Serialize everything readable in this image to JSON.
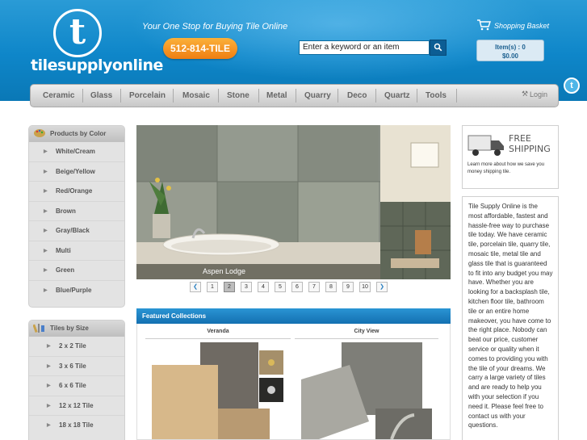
{
  "header": {
    "logo_letter": "t",
    "logo_text": "tilesupplyonline",
    "tagline": "Your One Stop for Buying Tile Online",
    "phone": "512-814-TILE",
    "search": {
      "value": "Enter a keyword or an item",
      "button_icon": "search-icon"
    },
    "basket": {
      "label": "Shopping Basket",
      "items_text": "Item(s) : 0",
      "total": "$0.00"
    }
  },
  "nav": {
    "items": [
      "Ceramic",
      "Glass",
      "Porcelain",
      "Mosaic",
      "Stone",
      "Metal",
      "Quarry",
      "Deco",
      "Quartz",
      "Tools"
    ],
    "login": "Login"
  },
  "sidebar": {
    "color": {
      "title": "Products by Color",
      "items": [
        "White/Cream",
        "Beige/Yellow",
        "Red/Orange",
        "Brown",
        "Gray/Black",
        "Multi",
        "Green",
        "Blue/Purple"
      ]
    },
    "size": {
      "title": "Tiles by Size",
      "items": [
        "2 x 2 Tile",
        "3 x 6 Tile",
        "6 x 6 Tile",
        "12 x 12 Tile",
        "18 x 18 Tile"
      ]
    }
  },
  "slider": {
    "caption": "Aspen Lodge",
    "pages": [
      "1",
      "2",
      "3",
      "4",
      "5",
      "6",
      "7",
      "8",
      "9",
      "10"
    ],
    "active_page": "2"
  },
  "featured": {
    "title": "Featured Collections",
    "collections": [
      "Veranda",
      "City View"
    ]
  },
  "shipping": {
    "title_line1": "FREE",
    "title_line2": "SHIPPING",
    "description": "Learn more about how we save you money shipping tile."
  },
  "about": {
    "text": "Tile Supply Online is the most affordable, fastest and hassle-free way to purchase tile today. We have ceramic tile, porcelain tile, quarry tile, mosaic tile, metal tile and glass tile that is guaranteed to fit into any budget you may have. Whether you are looking for a backsplash tile, kitchen floor tile, bathroom tile or an entire home makeover, you have come to the right place. Nobody can beat our price, customer service or quality when it comes to providing you with the tile of your dreams. We carry a large variety of tiles and are ready to help you with your selection if you need it. Please feel free to contact us with your questions."
  },
  "colors": {
    "header_blue": "#0e86c9",
    "phone_orange": "#f59a22",
    "featured_blue": "#1a7fc1"
  }
}
